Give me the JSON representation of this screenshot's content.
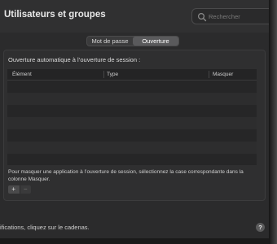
{
  "window": {
    "title": "Utilisateurs et groupes"
  },
  "search": {
    "placeholder": "Rechercher",
    "icon": "search-icon"
  },
  "tabs": [
    {
      "label": "Mot de passe",
      "active": false
    },
    {
      "label": "Ouverture",
      "active": true
    }
  ],
  "section": {
    "heading": "Ouverture automatique à l’ouverture de session :"
  },
  "table": {
    "columns": [
      "Élément",
      "Type",
      "Masquer"
    ],
    "rows": []
  },
  "hint": "Pour masquer une application à l’ouverture de session, sélectionnez la case correspondante dans la colonne Masquer.",
  "buttons": {
    "add": "+",
    "remove": "−"
  },
  "footer": {
    "text": "ifications, cliquez sur le cadenas.",
    "help": "?"
  },
  "colors": {
    "window_bg": "#2b2b2c",
    "active_tab": "#5a5a5c",
    "text": "#dcdcdc"
  }
}
